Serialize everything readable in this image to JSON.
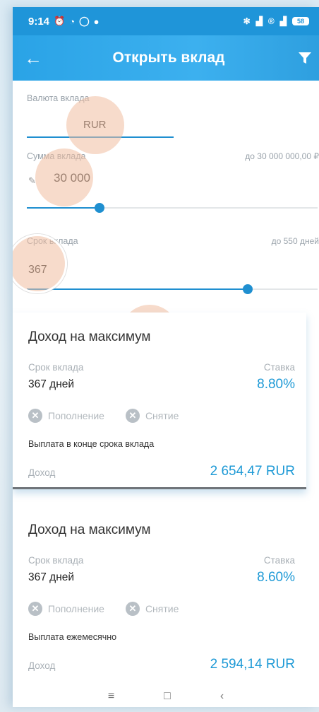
{
  "status": {
    "time": "9:14",
    "left_icons": [
      "alarm-off-icon",
      "alarm-icon",
      "whatsapp-icon",
      "message-icon"
    ],
    "right_icons": [
      "bluetooth-icon",
      "signal-4g-icon",
      "r-icon",
      "signal-icon"
    ],
    "battery": "58"
  },
  "appbar": {
    "title": "Открыть вклад",
    "back_icon": "arrow-left-icon",
    "filter_icon": "filter-icon"
  },
  "form": {
    "currency_label": "Валюта вклада",
    "currency_value": "RUR",
    "sum_label": "Сумма вклада",
    "sum_max": "до 30 000 000,00 ₽",
    "sum_value": "30 000",
    "sum_fraction": 0.25,
    "term_label": "Срок вклада",
    "term_max": "до 550 дней",
    "term_value": "367",
    "term_fraction": 0.76
  },
  "offers": [
    {
      "title": "Доход на максимум",
      "term_label": "Срок вклада",
      "term_value": "367 дней",
      "rate_label": "Ставка",
      "rate_value": "8.80%",
      "replenish": "Пополнение",
      "withdraw": "Снятие",
      "payout": "Выплата в конце срока вклада",
      "income_label": "Доход",
      "income_value": "2 654,47 RUR"
    },
    {
      "title": "Доход на максимум",
      "term_label": "Срок вклада",
      "term_value": "367 дней",
      "rate_label": "Ставка",
      "rate_value": "8.60%",
      "replenish": "Пополнение",
      "withdraw": "Снятие",
      "payout": "Выплата ежемесячно",
      "income_label": "Доход",
      "income_value": "2 594,14 RUR"
    }
  ],
  "navbar": {
    "menu": "≡",
    "home": "□",
    "back": "‹"
  },
  "colors": {
    "accent": "#1f8fd0",
    "appbar": "#2aa3e6",
    "rate": "#1f9ad6"
  }
}
